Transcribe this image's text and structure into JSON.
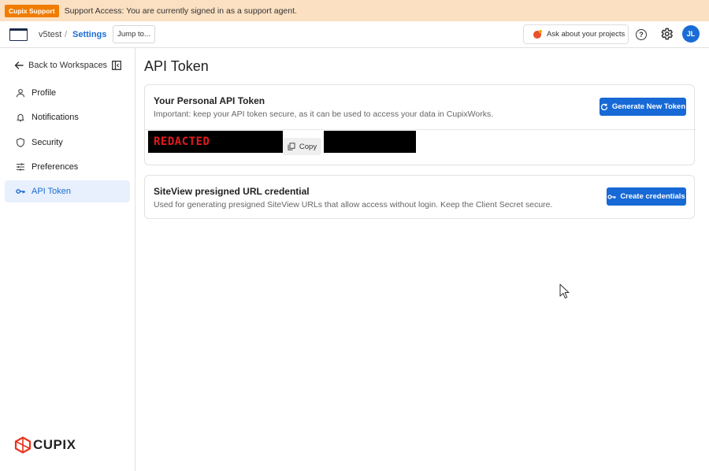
{
  "banner": {
    "badge": "Cupix Support",
    "message": "Support Access: You are currently signed in as a support agent."
  },
  "topbar": {
    "workspace": "v5test",
    "separator": "/",
    "section": "Settings",
    "jump_label": "Jump to...",
    "ask_label": "Ask about your projects",
    "help_glyph": "?",
    "avatar_initials": "JL",
    "icons": [
      "app-grid-icon",
      "help-icon",
      "gear-icon"
    ]
  },
  "sidebar": {
    "back_label": "Back to Workspaces",
    "items": [
      {
        "label": "Profile",
        "icon": "user-icon",
        "active": false
      },
      {
        "label": "Notifications",
        "icon": "bell-icon",
        "active": false
      },
      {
        "label": "Security",
        "icon": "shield-icon",
        "active": false
      },
      {
        "label": "Preferences",
        "icon": "sliders-icon",
        "active": false
      },
      {
        "label": "API Token",
        "icon": "key-icon",
        "active": true
      }
    ],
    "logo_text": "CUPIX"
  },
  "main": {
    "title": "API Token",
    "personal_card": {
      "title": "Your Personal API Token",
      "description": "Important: keep your API token secure, as it can be used to access your data in CupixWorks.",
      "button_label": "Generate New Token",
      "token_text": "REDACTED",
      "copy_label": "Copy"
    },
    "siteview_card": {
      "title": "SiteView presigned URL credential",
      "description": "Used for generating presigned SiteView URLs that allow access without login. Keep the Client Secret secure.",
      "button_label": "Create credentials"
    }
  },
  "colors": {
    "accent": "#1769d6",
    "banner_bg": "#fbe0c2",
    "badge_bg": "#f07d00",
    "active_nav_bg": "#e7f0fc",
    "redacted_text": "#e21b1b"
  }
}
